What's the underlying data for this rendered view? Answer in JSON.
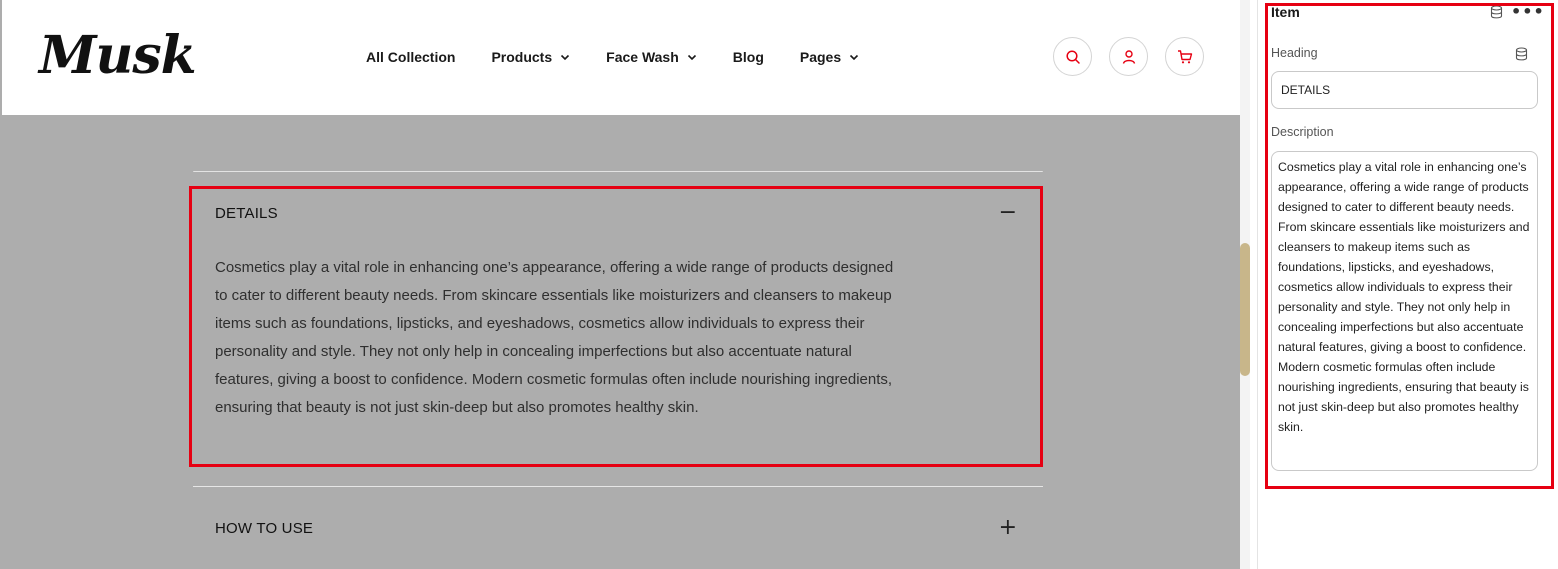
{
  "header": {
    "logo": "Musk",
    "nav": [
      {
        "label": "All Collection"
      },
      {
        "label": "Products"
      },
      {
        "label": "Face Wash"
      },
      {
        "label": "Blog"
      },
      {
        "label": "Pages"
      }
    ],
    "icons": [
      "search-icon",
      "user-icon",
      "cart-icon"
    ],
    "icon_color": "#e60012"
  },
  "accordion": {
    "items": [
      {
        "title": "DETAILS",
        "toggle": "−",
        "description": "Cosmetics play a vital role in enhancing one’s appearance, offering a wide range of products designed to cater to different beauty needs. From skincare essentials like moisturizers and cleansers to makeup items such as foundations, lipsticks, and eyeshadows, cosmetics allow individuals to express their personality and style. They not only help in concealing imperfections but also accentuate natural features, giving a boost to confidence. Modern cosmetic formulas often include nourishing ingredients, ensuring that beauty is not just skin-deep but also promotes healthy skin."
      },
      {
        "title": "HOW TO USE",
        "toggle": "+"
      }
    ],
    "highlight_color": "#e60012"
  },
  "editor": {
    "title": "Item",
    "heading_label": "Heading",
    "heading_value": "DETAILS",
    "description_label": "Description",
    "description_value": "Cosmetics play a vital role in enhancing one’s appearance, offering a wide range of products designed to cater to different beauty needs. From skincare essentials like moisturizers and cleansers to makeup items such as foundations, lipsticks, and eyeshadows, cosmetics allow individuals to express their personality and style. They not only help in concealing imperfections but also accentuate natural features, giving a boost to confidence. Modern cosmetic formulas often include nourishing ingredients, ensuring that beauty is not just skin-deep but also promotes healthy skin."
  }
}
